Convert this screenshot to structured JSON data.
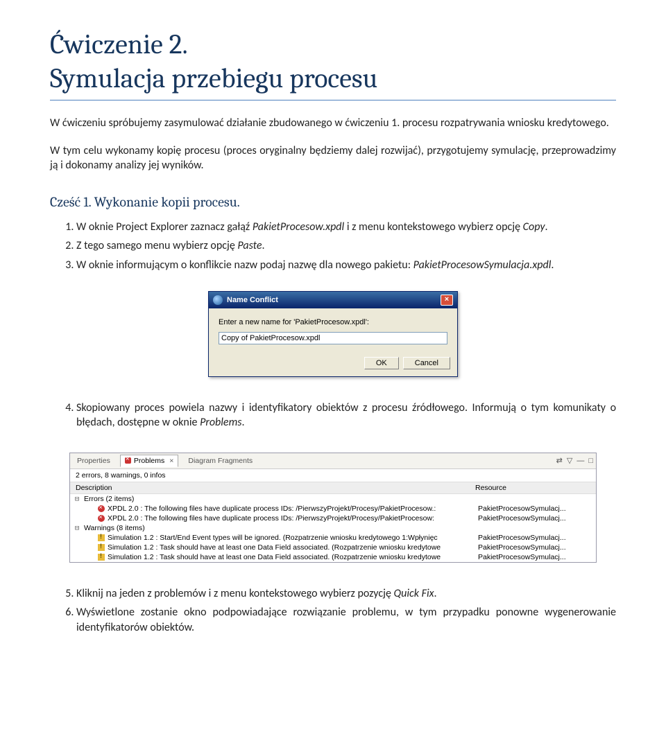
{
  "title1": "Ćwiczenie 2.",
  "title2": "Symulacja przebiegu procesu",
  "intro1": "W ćwiczeniu spróbujemy zasymulować działanie zbudowanego w ćwiczeniu 1. procesu rozpatrywania wniosku kredytowego.",
  "intro2": "W tym celu wykonamy kopię procesu (proces oryginalny będziemy dalej rozwijać), przygotujemy symulację, przeprowadzimy ją i dokonamy analizy jej wyników.",
  "section1": "Cześć 1. Wykonanie kopii procesu.",
  "steps_a": {
    "s1a": "W oknie Project Explorer zaznacz gałąź ",
    "s1b": "PakietProcesow.xpdl",
    "s1c": " i z menu kontekstowego wybierz opcję ",
    "s1d": "Copy",
    "s1e": ".",
    "s2a": "Z tego samego menu wybierz opcję ",
    "s2b": "Paste",
    "s2c": ".",
    "s3a": "W oknie informującym o konflikcie nazw podaj nazwę dla nowego pakietu: ",
    "s3b": "PakietProcesowSymulacja.xpdl",
    "s3c": "."
  },
  "dialog": {
    "title": "Name Conflict",
    "prompt": "Enter a new name for 'PakietProcesow.xpdl':",
    "value": "Copy of PakietProcesow.xpdl",
    "ok": "OK",
    "cancel": "Cancel"
  },
  "steps_b": {
    "s4a": "Skopiowany proces powiela nazwy i identyfikatory obiektów z procesu źródłowego. Informują o tym komunikaty o błędach, dostępne w oknie ",
    "s4b": "Problems",
    "s4c": "."
  },
  "panel": {
    "tabs": {
      "properties": "Properties",
      "problems": "Problems",
      "fragments": "Diagram Fragments"
    },
    "status": "2 errors, 8 warnings, 0 infos",
    "cols": {
      "desc": "Description",
      "res": "Resource"
    },
    "errGroup": "Errors (2 items)",
    "err1": "XPDL 2.0 : The following files have duplicate process IDs: /PierwszyProjekt/Procesy/PakietProcesow.:",
    "err2": "XPDL 2.0 : The following files have duplicate process IDs: /PierwszyProjekt/Procesy/PakietProcesow:",
    "warnGroup": "Warnings (8 items)",
    "w1": "Simulation 1.2 : Start/End Event types will be ignored. (Rozpatrzenie wniosku kredytowego 1:Wpłynięc",
    "w2": "Simulation 1.2 : Task should have at least one Data Field associated. (Rozpatrzenie wniosku kredytowe",
    "w3": "Simulation 1.2 : Task should have at least one Data Field associated. (Rozpatrzenie wniosku kredytowe",
    "resFile": "PakietProcesowSymulacj..."
  },
  "steps_c": {
    "s5a": "Kliknij na jeden z problemów i z menu kontekstowego wybierz pozycję ",
    "s5b": "Quick Fix",
    "s5c": ".",
    "s6": "Wyświetlone zostanie okno podpowiadające rozwiązanie problemu, w tym przypadku ponowne wygenerowanie identyfikatorów obiektów."
  }
}
